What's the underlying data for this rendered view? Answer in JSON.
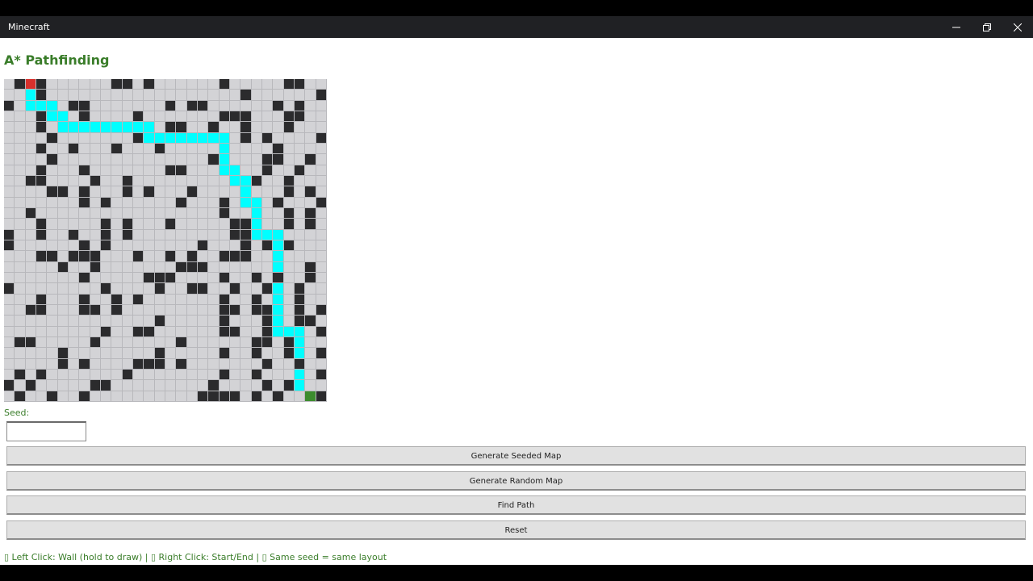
{
  "window": {
    "title": "Minecraft",
    "controls": [
      "minimize-icon",
      "restore-icon",
      "close-icon"
    ]
  },
  "main": {
    "heading": "A* Pathfinding",
    "seed_label": "Seed:",
    "seed_value": "",
    "buttons": {
      "generate_seeded": "Generate Seeded Map",
      "generate_random": "Generate Random Map",
      "find_path": "Find Path",
      "reset": "Reset"
    },
    "instructions": "▯ Left Click: Wall (hold to draw) | ▯ Right Click: Start/End | ▯ Same seed = same layout"
  },
  "grid": {
    "rows": 30,
    "cols": 30,
    "colors": {
      "empty": "#d3d3d6",
      "wall": "#2b2b2d",
      "path": "#00ffff",
      "start": "#d7302c",
      "end": "#3c8c2d"
    },
    "start": [
      0,
      2
    ],
    "end": [
      29,
      28
    ],
    "walls": [
      [
        0,
        1
      ],
      [
        0,
        3
      ],
      [
        0,
        10
      ],
      [
        0,
        11
      ],
      [
        0,
        13
      ],
      [
        0,
        20
      ],
      [
        0,
        26
      ],
      [
        0,
        27
      ],
      [
        1,
        3
      ],
      [
        1,
        22
      ],
      [
        1,
        29
      ],
      [
        2,
        0
      ],
      [
        2,
        6
      ],
      [
        2,
        7
      ],
      [
        2,
        15
      ],
      [
        2,
        17
      ],
      [
        2,
        18
      ],
      [
        2,
        25
      ],
      [
        2,
        27
      ],
      [
        3,
        3
      ],
      [
        3,
        7
      ],
      [
        3,
        12
      ],
      [
        3,
        20
      ],
      [
        3,
        21
      ],
      [
        3,
        22
      ],
      [
        3,
        26
      ],
      [
        3,
        27
      ],
      [
        4,
        3
      ],
      [
        4,
        15
      ],
      [
        4,
        16
      ],
      [
        4,
        19
      ],
      [
        4,
        22
      ],
      [
        4,
        26
      ],
      [
        5,
        4
      ],
      [
        5,
        12
      ],
      [
        5,
        22
      ],
      [
        5,
        24
      ],
      [
        5,
        29
      ],
      [
        6,
        3
      ],
      [
        6,
        6
      ],
      [
        6,
        10
      ],
      [
        6,
        14
      ],
      [
        6,
        25
      ],
      [
        7,
        4
      ],
      [
        7,
        19
      ],
      [
        7,
        24
      ],
      [
        7,
        25
      ],
      [
        7,
        28
      ],
      [
        8,
        3
      ],
      [
        8,
        7
      ],
      [
        8,
        15
      ],
      [
        8,
        16
      ],
      [
        8,
        24
      ],
      [
        8,
        27
      ],
      [
        9,
        2
      ],
      [
        9,
        3
      ],
      [
        9,
        8
      ],
      [
        9,
        11
      ],
      [
        9,
        23
      ],
      [
        9,
        26
      ],
      [
        10,
        4
      ],
      [
        10,
        5
      ],
      [
        10,
        7
      ],
      [
        10,
        11
      ],
      [
        10,
        13
      ],
      [
        10,
        17
      ],
      [
        10,
        26
      ],
      [
        10,
        28
      ],
      [
        11,
        7
      ],
      [
        11,
        9
      ],
      [
        11,
        16
      ],
      [
        11,
        20
      ],
      [
        11,
        25
      ],
      [
        11,
        29
      ],
      [
        12,
        2
      ],
      [
        12,
        20
      ],
      [
        12,
        26
      ],
      [
        12,
        28
      ],
      [
        13,
        3
      ],
      [
        13,
        9
      ],
      [
        13,
        11
      ],
      [
        13,
        15
      ],
      [
        13,
        21
      ],
      [
        13,
        22
      ],
      [
        13,
        26
      ],
      [
        13,
        28
      ],
      [
        14,
        0
      ],
      [
        14,
        3
      ],
      [
        14,
        6
      ],
      [
        14,
        9
      ],
      [
        14,
        11
      ],
      [
        14,
        21
      ],
      [
        14,
        22
      ],
      [
        15,
        0
      ],
      [
        15,
        7
      ],
      [
        15,
        9
      ],
      [
        15,
        18
      ],
      [
        15,
        22
      ],
      [
        15,
        24
      ],
      [
        15,
        26
      ],
      [
        16,
        3
      ],
      [
        16,
        4
      ],
      [
        16,
        6
      ],
      [
        16,
        7
      ],
      [
        16,
        8
      ],
      [
        16,
        12
      ],
      [
        16,
        15
      ],
      [
        16,
        17
      ],
      [
        16,
        20
      ],
      [
        16,
        21
      ],
      [
        16,
        22
      ],
      [
        17,
        5
      ],
      [
        17,
        8
      ],
      [
        17,
        16
      ],
      [
        17,
        17
      ],
      [
        17,
        18
      ],
      [
        17,
        28
      ],
      [
        18,
        7
      ],
      [
        18,
        13
      ],
      [
        18,
        14
      ],
      [
        18,
        15
      ],
      [
        18,
        20
      ],
      [
        18,
        23
      ],
      [
        18,
        25
      ],
      [
        18,
        28
      ],
      [
        19,
        0
      ],
      [
        19,
        9
      ],
      [
        19,
        14
      ],
      [
        19,
        17
      ],
      [
        19,
        18
      ],
      [
        19,
        21
      ],
      [
        19,
        24
      ],
      [
        19,
        27
      ],
      [
        20,
        3
      ],
      [
        20,
        7
      ],
      [
        20,
        10
      ],
      [
        20,
        12
      ],
      [
        20,
        20
      ],
      [
        20,
        23
      ],
      [
        20,
        27
      ],
      [
        21,
        2
      ],
      [
        21,
        3
      ],
      [
        21,
        7
      ],
      [
        21,
        8
      ],
      [
        21,
        10
      ],
      [
        21,
        20
      ],
      [
        21,
        21
      ],
      [
        21,
        23
      ],
      [
        21,
        24
      ],
      [
        21,
        27
      ],
      [
        21,
        29
      ],
      [
        22,
        14
      ],
      [
        22,
        20
      ],
      [
        22,
        24
      ],
      [
        22,
        27
      ],
      [
        22,
        28
      ],
      [
        23,
        9
      ],
      [
        23,
        12
      ],
      [
        23,
        13
      ],
      [
        23,
        20
      ],
      [
        23,
        21
      ],
      [
        23,
        24
      ],
      [
        23,
        29
      ],
      [
        24,
        1
      ],
      [
        24,
        2
      ],
      [
        24,
        8
      ],
      [
        24,
        16
      ],
      [
        24,
        23
      ],
      [
        24,
        24
      ],
      [
        24,
        26
      ],
      [
        25,
        5
      ],
      [
        25,
        14
      ],
      [
        25,
        20
      ],
      [
        25,
        23
      ],
      [
        25,
        26
      ],
      [
        25,
        29
      ],
      [
        26,
        5
      ],
      [
        26,
        7
      ],
      [
        26,
        12
      ],
      [
        26,
        13
      ],
      [
        26,
        14
      ],
      [
        26,
        16
      ],
      [
        26,
        24
      ],
      [
        26,
        27
      ],
      [
        27,
        1
      ],
      [
        27,
        3
      ],
      [
        27,
        11
      ],
      [
        27,
        20
      ],
      [
        27,
        23
      ],
      [
        27,
        29
      ],
      [
        28,
        0
      ],
      [
        28,
        2
      ],
      [
        28,
        8
      ],
      [
        28,
        9
      ],
      [
        28,
        19
      ],
      [
        28,
        24
      ],
      [
        28,
        26
      ],
      [
        29,
        1
      ],
      [
        29,
        4
      ],
      [
        29,
        7
      ],
      [
        29,
        18
      ],
      [
        29,
        19
      ],
      [
        29,
        20
      ],
      [
        29,
        21
      ],
      [
        29,
        23
      ],
      [
        29,
        25
      ],
      [
        29,
        29
      ]
    ],
    "path": [
      [
        1,
        2
      ],
      [
        2,
        2
      ],
      [
        2,
        3
      ],
      [
        2,
        4
      ],
      [
        3,
        4
      ],
      [
        3,
        5
      ],
      [
        4,
        5
      ],
      [
        4,
        6
      ],
      [
        4,
        7
      ],
      [
        4,
        8
      ],
      [
        4,
        9
      ],
      [
        4,
        10
      ],
      [
        4,
        11
      ],
      [
        4,
        12
      ],
      [
        4,
        13
      ],
      [
        5,
        13
      ],
      [
        5,
        14
      ],
      [
        5,
        15
      ],
      [
        5,
        16
      ],
      [
        5,
        17
      ],
      [
        5,
        18
      ],
      [
        5,
        19
      ],
      [
        5,
        20
      ],
      [
        6,
        20
      ],
      [
        7,
        20
      ],
      [
        8,
        20
      ],
      [
        8,
        21
      ],
      [
        9,
        21
      ],
      [
        9,
        22
      ],
      [
        10,
        22
      ],
      [
        11,
        22
      ],
      [
        11,
        23
      ],
      [
        12,
        23
      ],
      [
        13,
        23
      ],
      [
        14,
        23
      ],
      [
        14,
        24
      ],
      [
        14,
        25
      ],
      [
        15,
        25
      ],
      [
        16,
        25
      ],
      [
        17,
        25
      ],
      [
        18,
        25
      ],
      [
        19,
        25
      ],
      [
        20,
        25
      ],
      [
        21,
        25
      ],
      [
        22,
        25
      ],
      [
        23,
        25
      ],
      [
        23,
        26
      ],
      [
        23,
        27
      ],
      [
        24,
        27
      ],
      [
        25,
        27
      ],
      [
        26,
        27
      ],
      [
        27,
        27
      ],
      [
        28,
        27
      ]
    ]
  }
}
